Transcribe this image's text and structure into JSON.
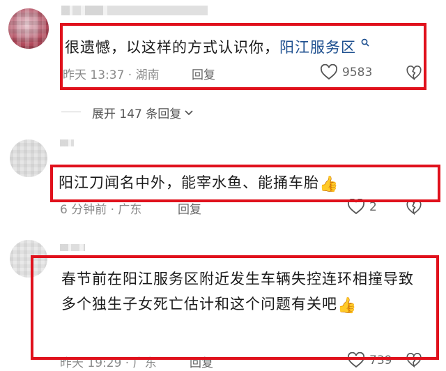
{
  "comments": [
    {
      "text_prefix": "很遗憾，以这样的方式认识你，",
      "text_link": "阳江服务区",
      "meta": "昨天 13:37 · 湖南",
      "reply_label": "回复",
      "likes": "9583",
      "expand_label": "展开 147 条回复"
    },
    {
      "text": "阳江刀闻名中外，能宰水鱼、能捅车胎",
      "emoji": "👍",
      "meta": "6 分钟前 · 广东",
      "reply_label": "回复",
      "likes": "2"
    },
    {
      "text": "春节前在阳江服务区附近发生车辆失控连环相撞导致多个独生子女死亡估计和这个问题有关吧",
      "emoji": "👍",
      "meta": "昨天 19:29 · 广东",
      "reply_label": "回复",
      "likes": "739"
    }
  ],
  "colors": {
    "highlight_border": "#e0111c",
    "link": "#1d4f8f",
    "meta": "#8a8a8a"
  },
  "icons": {
    "like": "heart-outline-icon",
    "dislike": "broken-heart-icon",
    "search": "search-icon",
    "expand": "chevron-down-icon"
  }
}
